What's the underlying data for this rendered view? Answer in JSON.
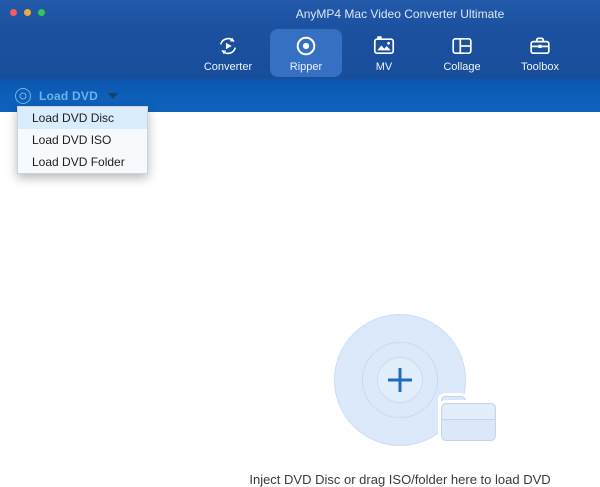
{
  "window": {
    "title": "AnyMP4 Mac Video Converter Ultimate"
  },
  "nav": {
    "active_tab": "Ripper",
    "tabs": [
      {
        "label": "Converter",
        "icon": "convert-cycle-play-icon"
      },
      {
        "label": "Ripper",
        "icon": "disc-record-icon"
      },
      {
        "label": "MV",
        "icon": "tv-picture-icon"
      },
      {
        "label": "Collage",
        "icon": "collage-grid-icon"
      },
      {
        "label": "Toolbox",
        "icon": "toolbox-case-icon"
      }
    ]
  },
  "toolbar": {
    "load_dvd_label": "Load DVD",
    "load_dvd_icon": "dvd-disc-icon",
    "caret_icon": "chevron-down-icon"
  },
  "dropdown": {
    "highlighted": "Load DVD Disc",
    "items": [
      {
        "label": "Load DVD Disc"
      },
      {
        "label": "Load DVD ISO"
      },
      {
        "label": "Load DVD Folder"
      }
    ]
  },
  "main": {
    "drop_hint": "Inject DVD Disc or drag ISO/folder here to load DVD",
    "center_icons": [
      "dvd-disc-large-icon",
      "plus-icon",
      "folder-icon"
    ]
  },
  "colors": {
    "chrome_blue": "#1b519f",
    "toolbar_blue": "#0d5fb9",
    "active_tab_blue": "#3570c3",
    "load_dvd_text": "#66b5ec",
    "menu_highlight": "#d8ecfb",
    "disc_fill": "#dce9fa",
    "plus_blue": "#1d6cbd",
    "traffic_red": "#f2605a",
    "traffic_yellow": "#f2a83b",
    "traffic_green": "#39c553"
  }
}
